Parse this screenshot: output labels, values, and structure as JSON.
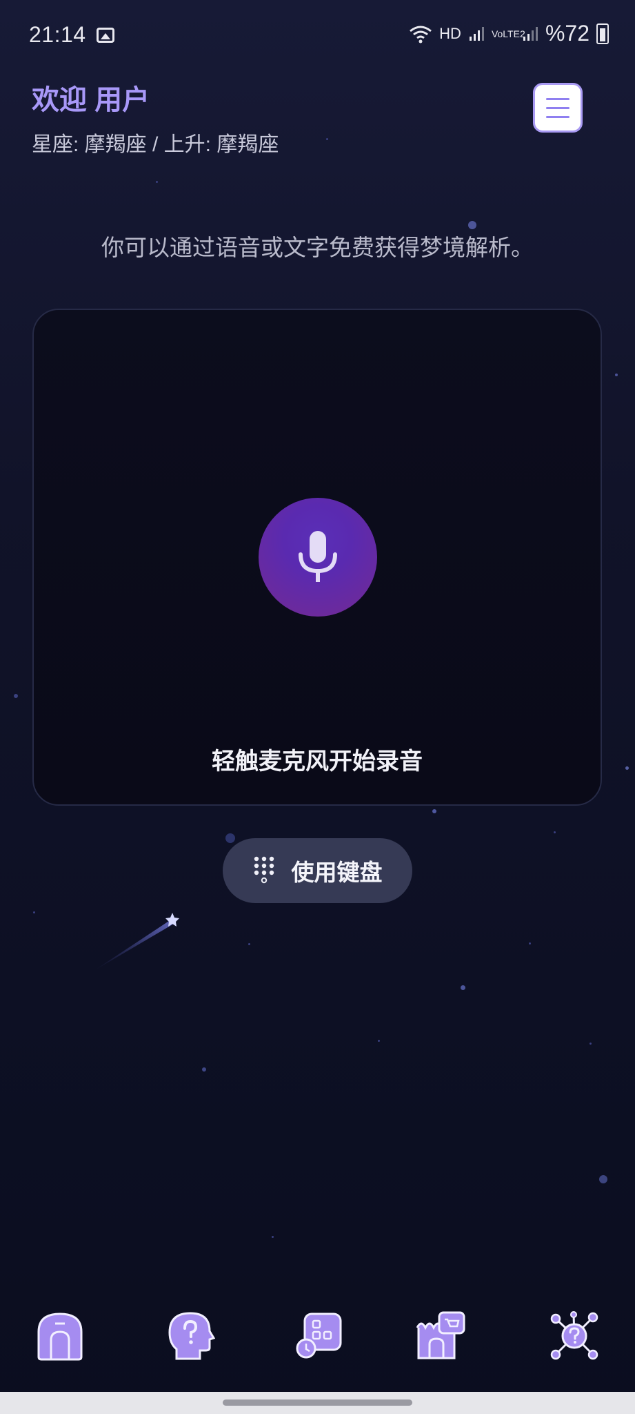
{
  "status_bar": {
    "time": "21:14",
    "network_label": "HD",
    "sim_label": "VoLTE2",
    "battery_text": "%72"
  },
  "header": {
    "welcome": "欢迎 用户",
    "sign_info": "星座: 摩羯座 / 上升: 摩羯座"
  },
  "hint_text": "你可以通过语音或文字免费获得梦境解析。",
  "voice": {
    "record_label": "轻触麦克风开始录音"
  },
  "keyboard": {
    "label": "使用键盘"
  },
  "colors": {
    "accent": "#a898f8",
    "mic_gradient_top": "#5a2fb7",
    "mic_gradient_bottom": "#7a2a8e",
    "background": "#111329"
  },
  "nav_icons": [
    "home-icon",
    "head-question-icon",
    "history-apps-icon",
    "shop-icon",
    "network-question-icon"
  ]
}
